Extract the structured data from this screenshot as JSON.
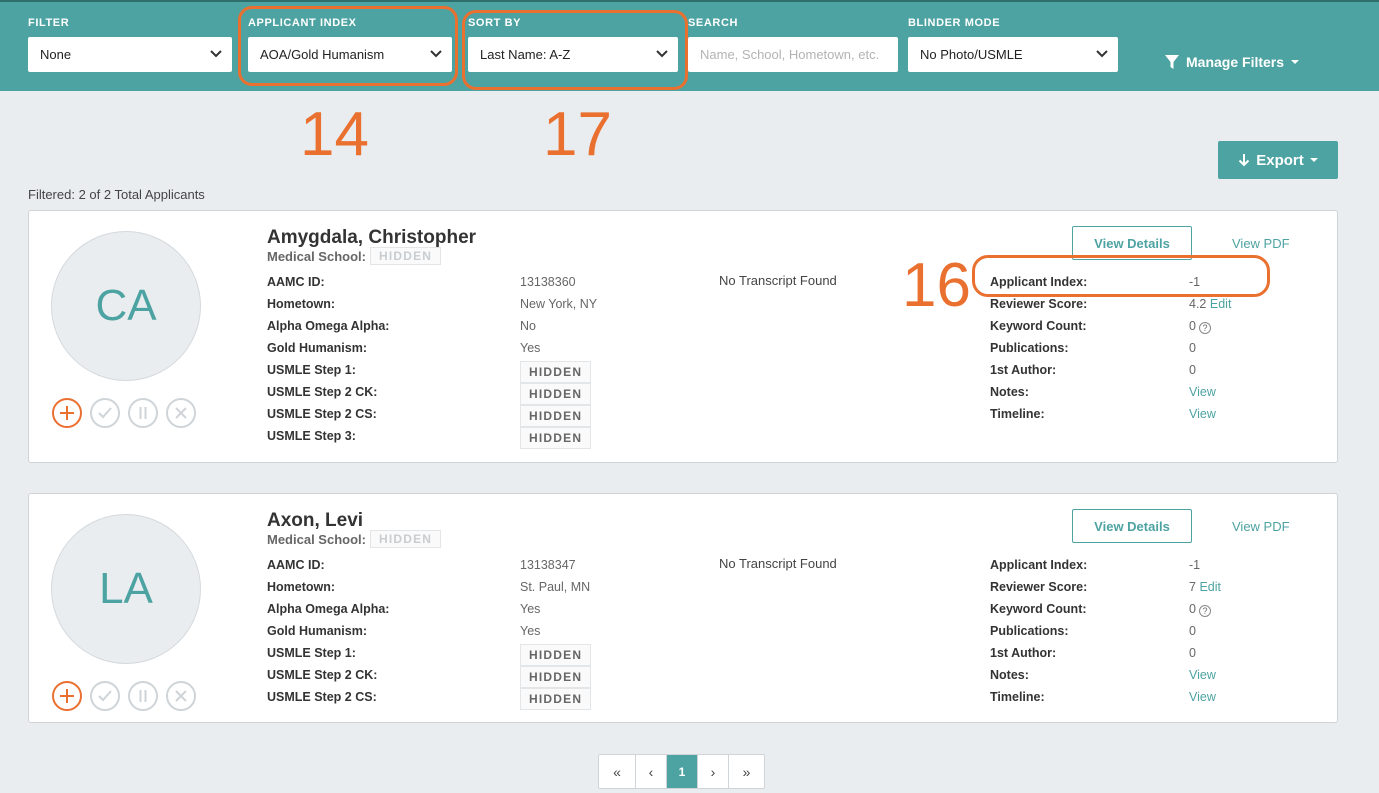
{
  "filters": {
    "filter": {
      "label": "FILTER",
      "value": "None"
    },
    "applicant_index": {
      "label": "APPLICANT INDEX",
      "value": "AOA/Gold Humanism"
    },
    "sort_by": {
      "label": "SORT BY",
      "value": "Last Name: A-Z"
    },
    "search": {
      "label": "SEARCH",
      "placeholder": "Name, School, Hometown, etc."
    },
    "blinder_mode": {
      "label": "BLINDER MODE",
      "value": "No Photo/USMLE"
    },
    "manage_label": "Manage Filters"
  },
  "annotations": [
    "14",
    "17",
    "16"
  ],
  "toolbar": {
    "export_label": "Export"
  },
  "summary": "Filtered: 2 of 2 Total Applicants",
  "common": {
    "hidden": "HIDDEN",
    "school_label": "Medical School:",
    "view_details": "View Details",
    "view_pdf": "View PDF",
    "edit": "Edit",
    "view": "View",
    "left_labels": [
      "AAMC ID:",
      "Hometown:",
      "Alpha Omega Alpha:",
      "Gold Humanism:",
      "USMLE Step 1:",
      "USMLE Step 2 CK:",
      "USMLE Step 2 CS:",
      "USMLE Step 3:"
    ],
    "right_labels": [
      "Applicant Index:",
      "Reviewer Score:",
      "Keyword Count:",
      "Publications:",
      "1st Author:",
      "Notes:",
      "Timeline:"
    ]
  },
  "applicants": [
    {
      "initials": "CA",
      "name": "Amygdala, Christopher",
      "aamc_id": "13138360",
      "hometown": "New York, NY",
      "aoa": "No",
      "gold_humanism": "Yes",
      "transcript": "No Transcript Found",
      "applicant_index": "-1",
      "reviewer_score": "4.2",
      "keyword_count": "0",
      "publications": "0",
      "first_author": "0"
    },
    {
      "initials": "LA",
      "name": "Axon, Levi",
      "aamc_id": "13138347",
      "hometown": "St. Paul, MN",
      "aoa": "Yes",
      "gold_humanism": "Yes",
      "transcript": "No Transcript Found",
      "applicant_index": "-1",
      "reviewer_score": "7",
      "keyword_count": "0",
      "publications": "0",
      "first_author": "0"
    }
  ],
  "pagination": {
    "first": "«",
    "prev": "‹",
    "current": "1",
    "next": "›",
    "last": "»"
  }
}
